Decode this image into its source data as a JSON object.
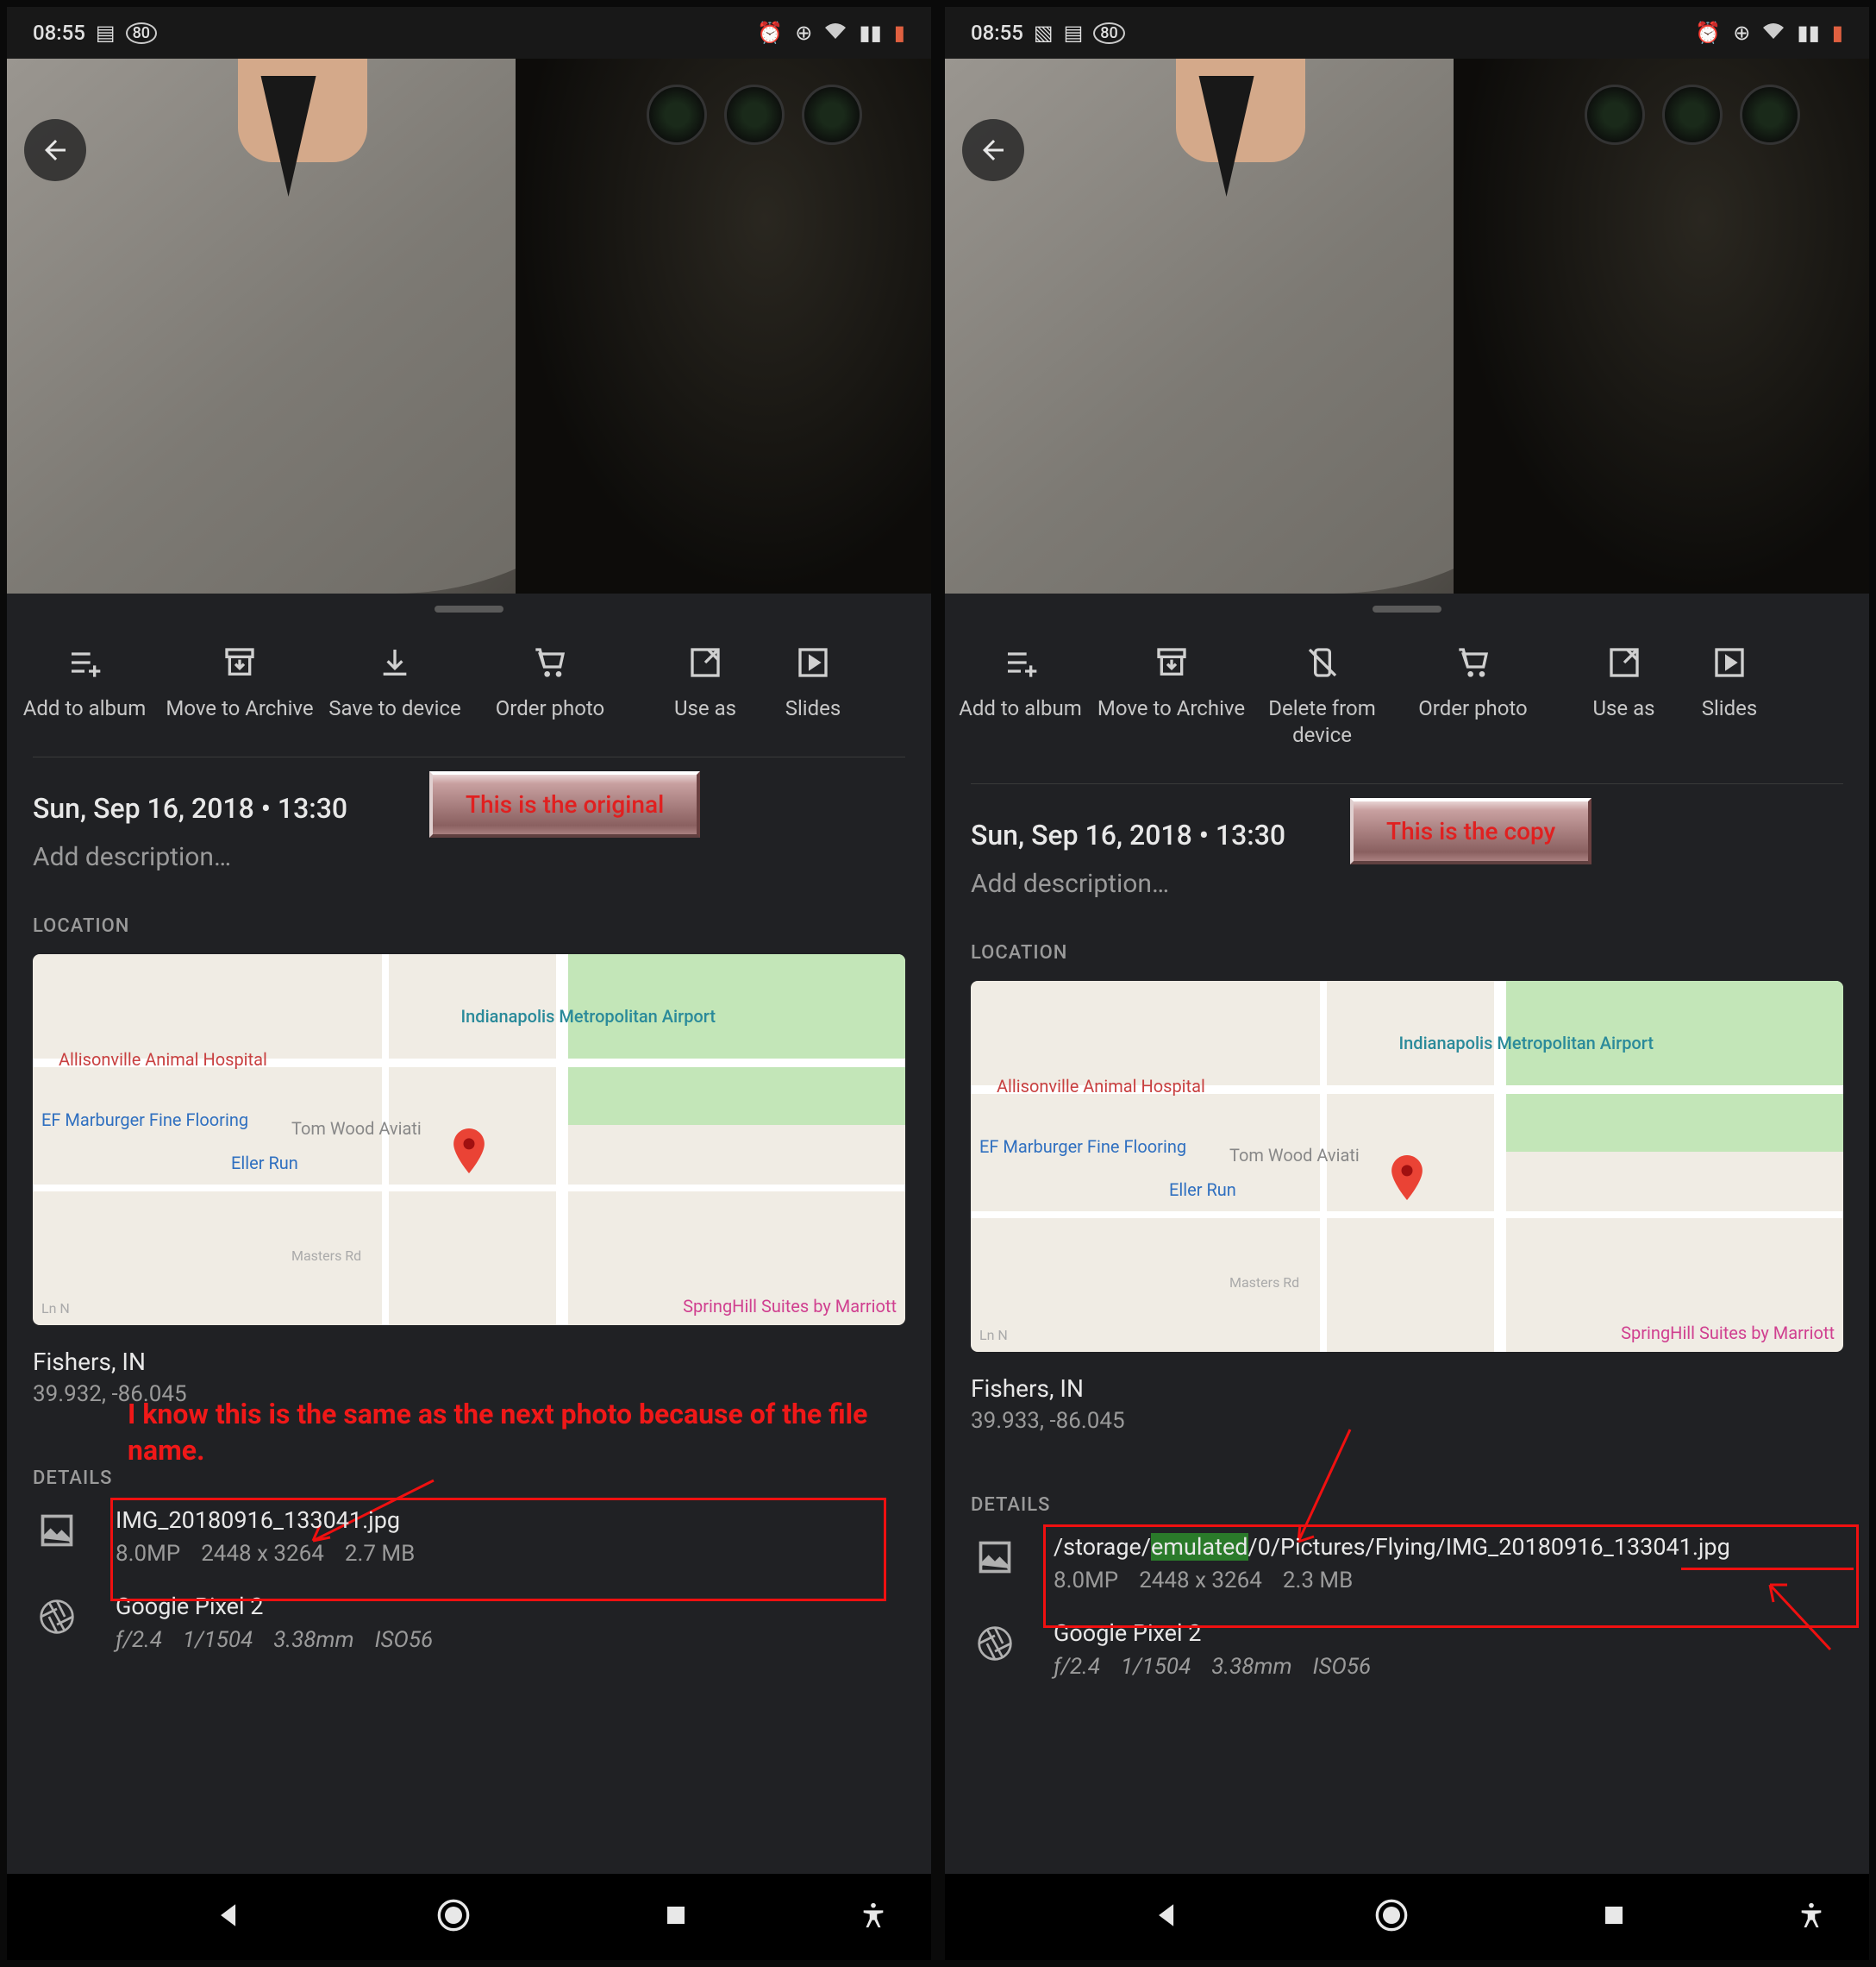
{
  "left": {
    "status": {
      "time": "08:55",
      "battery": "80"
    },
    "actions": [
      {
        "icon": "add-to-album-icon",
        "label": "Add to album"
      },
      {
        "icon": "archive-icon",
        "label": "Move to Archive"
      },
      {
        "icon": "download-icon",
        "label": "Save to device"
      },
      {
        "icon": "cart-icon",
        "label": "Order photo"
      },
      {
        "icon": "use-as-icon",
        "label": "Use as"
      },
      {
        "icon": "slideshow-icon",
        "label": "Slides"
      }
    ],
    "date": "Sun, Sep 16, 2018  •  13:30",
    "desc_placeholder": "Add description…",
    "badge": "This is the original",
    "section_location": "LOCATION",
    "map": {
      "airport": "Indianapolis Metropolitan Airport",
      "poi1": "Allisonville Animal Hospital",
      "poi2": "EF Marburger Fine Flooring",
      "poi3": "Tom Wood Aviati",
      "poi4": "Eller Run",
      "poi5": "Masters Rd",
      "poi6": "Ln N",
      "poi7": "SpringHill Suites by Marriott"
    },
    "loc_city": "Fishers, IN",
    "loc_coords": "39.932, -86.045",
    "annotation": "I know this is the same as the next photo because of the file name.",
    "section_details": "DETAILS",
    "file": {
      "name": "IMG_20180916_133041.jpg",
      "mp": "8.0MP",
      "dim": "2448 x 3264",
      "size": "2.7 MB"
    },
    "camera": {
      "name": "Google Pixel 2",
      "f": "ƒ/2.4",
      "sh": "1/1504",
      "fl": "3.38mm",
      "iso": "ISO56"
    }
  },
  "right": {
    "status": {
      "time": "08:55",
      "battery": "80"
    },
    "actions": [
      {
        "icon": "add-to-album-icon",
        "label": "Add to album"
      },
      {
        "icon": "archive-icon",
        "label": "Move to Archive"
      },
      {
        "icon": "delete-device-icon",
        "label": "Delete from device"
      },
      {
        "icon": "cart-icon",
        "label": "Order photo"
      },
      {
        "icon": "use-as-icon",
        "label": "Use as"
      },
      {
        "icon": "slideshow-icon",
        "label": "Slides"
      }
    ],
    "date": "Sun, Sep 16, 2018  •  13:30",
    "desc_placeholder": "Add description…",
    "badge": "This is the copy",
    "section_location": "LOCATION",
    "loc_city": "Fishers, IN",
    "loc_coords": "39.933, -86.045",
    "section_details": "DETAILS",
    "file": {
      "path_pre": "/storage/",
      "path_hl": "emulated",
      "path_post": "/0/Pictures/Flying/IMG_20180916_133041.jpg",
      "mp": "8.0MP",
      "dim": "2448 x 3264",
      "size": "2.3 MB"
    },
    "camera": {
      "name": "Google Pixel 2",
      "f": "ƒ/2.4",
      "sh": "1/1504",
      "fl": "3.38mm",
      "iso": "ISO56"
    }
  }
}
